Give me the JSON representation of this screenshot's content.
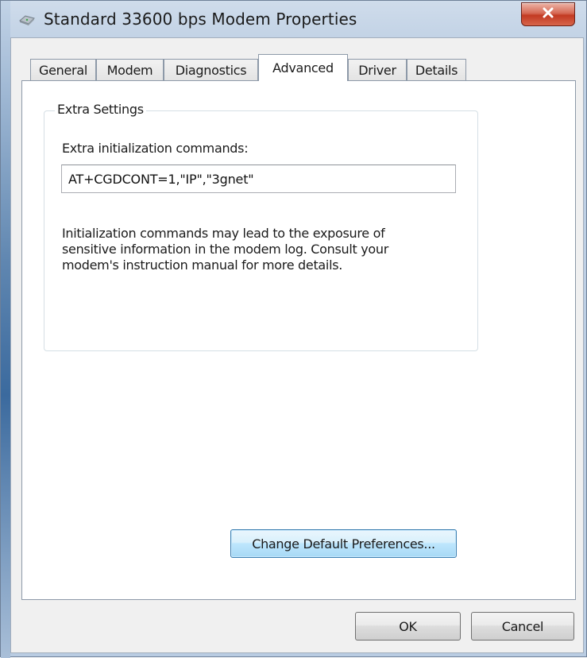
{
  "window": {
    "title": "Standard 33600 bps Modem Properties",
    "icon": "modem-icon",
    "close_icon": "close-icon"
  },
  "tabs": [
    {
      "label": "General",
      "active": false
    },
    {
      "label": "Modem",
      "active": false
    },
    {
      "label": "Diagnostics",
      "active": false
    },
    {
      "label": "Advanced",
      "active": true
    },
    {
      "label": "Driver",
      "active": false
    },
    {
      "label": "Details",
      "active": false
    }
  ],
  "advanced": {
    "group_title": "Extra Settings",
    "init_label": "Extra initialization commands:",
    "init_value": "AT+CGDCONT=1,\"IP\",\"3gnet\"",
    "info_text": "Initialization commands may lead to the exposure of sensitive information in the modem log. Consult your modem's instruction manual for more details.",
    "change_defaults_label": "Change Default Preferences..."
  },
  "footer": {
    "ok_label": "OK",
    "cancel_label": "Cancel"
  },
  "colors": {
    "close_button": "#c94a33",
    "focus_border": "#3c7fb1",
    "panel": "#ffffff",
    "dialog_face": "#f0f0f0"
  }
}
